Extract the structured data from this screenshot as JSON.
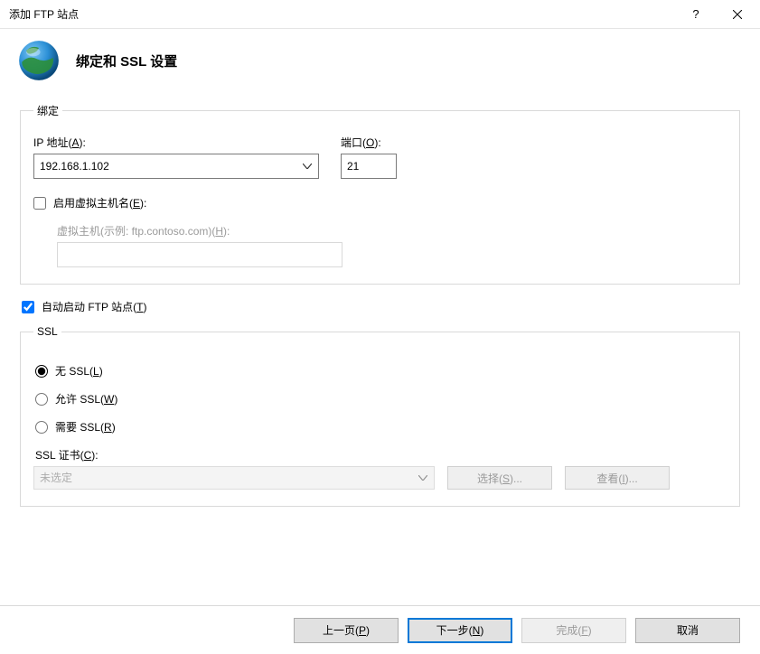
{
  "titlebar": {
    "title": "添加 FTP 站点"
  },
  "header": {
    "heading": "绑定和 SSL 设置"
  },
  "binding": {
    "legend": "绑定",
    "ip_label": "IP 地址(A):",
    "ip_value": "192.168.1.102",
    "port_label": "端口(O):",
    "port_value": "21",
    "enable_vhost_label": "启用虚拟主机名(E):",
    "enable_vhost_checked": false,
    "vhost_label": "虚拟主机(示例: ftp.contoso.com)(H):",
    "vhost_value": ""
  },
  "autostart": {
    "label": "自动启动 FTP 站点(T)",
    "checked": true
  },
  "ssl": {
    "legend": "SSL",
    "none_label": "无 SSL(L)",
    "allow_label": "允许 SSL(W)",
    "require_label": "需要 SSL(R)",
    "selected": "none",
    "cert_label": "SSL 证书(C):",
    "cert_value": "未选定",
    "select_btn": "选择(S)...",
    "view_btn": "查看(I)..."
  },
  "footer": {
    "prev": "上一页(P)",
    "next": "下一步(N)",
    "finish": "完成(F)",
    "cancel": "取消"
  }
}
